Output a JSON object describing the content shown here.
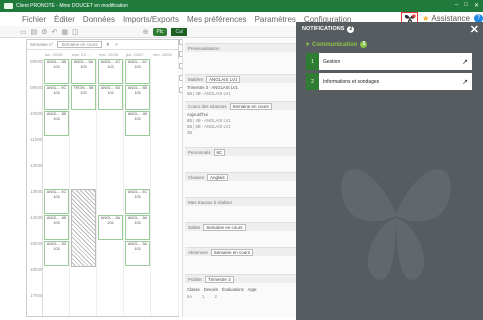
{
  "window": {
    "title": "Client PRONOTE - Mme DOUCET en modification"
  },
  "menu": [
    "Fichier",
    "Éditer",
    "Données",
    "Imports/Exports",
    "Mes préférences",
    "Paramètres",
    "Configuration"
  ],
  "toolbar": {
    "pill1": "Plc",
    "pill2": "Cal"
  },
  "topbar": {
    "assistance": "Assistance",
    "help": "?"
  },
  "schedule": {
    "week_label": "Semaine en cours",
    "header_left": "Semaine n°",
    "days": [
      "lun. 20/06",
      "mar. 21/...",
      "mer. 22/06",
      "jeu. 23/07",
      "ven. 24/06"
    ],
    "hours": [
      "08h00",
      "09h00",
      "10h00",
      "11h00",
      "12h00",
      "13h00",
      "14h00",
      "15h00",
      "16h00",
      "17h00"
    ],
    "courses": [
      {
        "t": "ANGL... 6B 103"
      },
      {
        "t": "ANGL... 5A 103"
      },
      {
        "t": "ANGL... 4C 103"
      },
      {
        "t": "ANGL... 6C 103"
      },
      {
        "t": "ANGL... 5C 103"
      },
      {
        "t": "TROM... 5B 103"
      },
      {
        "t": "ANGL... 5D 103"
      },
      {
        "t": "ANGL... 6B 103"
      },
      {
        "t": "ANGL... 5B 103"
      },
      {
        "t": "ANGL... 4B 103"
      },
      {
        "t": "ANGL... 4C 103"
      },
      {
        "t": "ANGL... 6C 103"
      },
      {
        "t": "ANGL... 4B 103"
      },
      {
        "t": "ANGL... 5A 204"
      },
      {
        "t": "ANGL... 5A 103"
      },
      {
        "t": "ANGL... 3D 103"
      },
      {
        "t": "ANGL... 5A 103"
      }
    ]
  },
  "details": {
    "sections": [
      {
        "label": "Prévisualisation",
        "box": ""
      },
      {
        "label": "Matière",
        "box": "ANGLAIS LV1"
      },
      {
        "label": "Cours des séances",
        "box": "Semaine en cours"
      },
      {
        "label": "Personnels",
        "box": "6C"
      },
      {
        "label": "Classes",
        "box": "Anglais"
      },
      {
        "label": "Mes travaux à réaliser",
        "box": ""
      },
      {
        "label": "Salles",
        "box": "Semaine en cours"
      },
      {
        "label": "Absences",
        "box": "Semaine en cours"
      },
      {
        "label": "Publier",
        "box": "Trimestre 3"
      }
    ],
    "lines": [
      "Trimestre 3 - ANGLAIS LV1",
      "6B | 4B - ANGLAIS LV1",
      "Aujourd'hui",
      "6B | 4B - ANGLAIS LV1",
      "6B | 5B - ANGLAIS LV1",
      "3B"
    ],
    "table_head": [
      "Classe",
      "Devoirs",
      "Évaluations",
      "Appr."
    ],
    "table_row": [
      "5A",
      "1",
      "2"
    ]
  },
  "notifications": {
    "title": "NOTIFICATIONS",
    "count": "2",
    "section": "Communication",
    "section_count": "2",
    "items": [
      {
        "num": "1",
        "label": "Gestion"
      },
      {
        "num": "2",
        "label": "Informations et sondages"
      }
    ]
  }
}
